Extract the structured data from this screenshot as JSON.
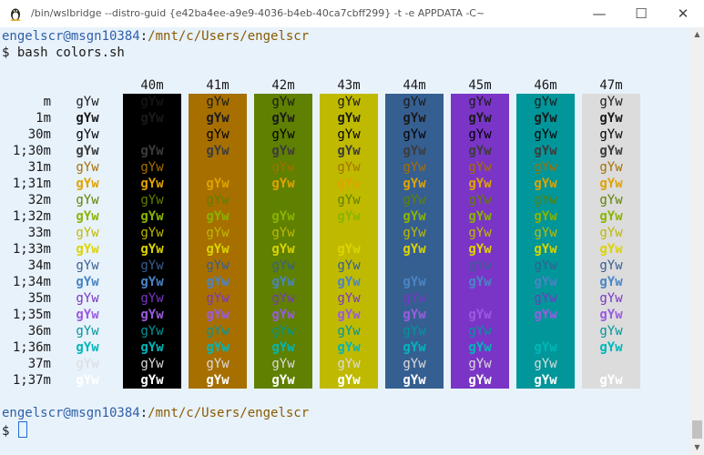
{
  "window": {
    "title": "/bin/wslbridge --distro-guid {e42ba4ee-a9e9-4036-b4eb-40ca7cbff299} -t -e APPDATA -C~",
    "minimize": "—",
    "maximize": "☐",
    "close": "✕",
    "icon": "tux-penguin-icon"
  },
  "terminal": {
    "prompt1": {
      "user_host": "engelscr@msgn10384",
      "colon": ":",
      "path": "/mnt/c/Users/engelscr"
    },
    "command": "$ bash colors.sh",
    "prompt2": {
      "user_host": "engelscr@msgn10384",
      "colon": ":",
      "path": "/mnt/c/Users/engelscr"
    },
    "prompt_line": "$ "
  },
  "colors": {
    "prompt_user": "#2f5ea8",
    "prompt_path": "#8a5a00",
    "bg_40": "#000000",
    "bg_41": "#a66f00",
    "bg_42": "#5f8000",
    "bg_43": "#bfba00",
    "bg_44": "#365f91",
    "bg_45": "#7a35c6",
    "bg_46": "#00969a",
    "bg_47": "#dcdcdc"
  },
  "grid": {
    "sample": "gYw",
    "columns": [
      "40m",
      "41m",
      "42m",
      "43m",
      "44m",
      "45m",
      "46m",
      "47m"
    ],
    "rows": [
      "m",
      "1m",
      "30m",
      "1;30m",
      "31m",
      "1;31m",
      "32m",
      "1;32m",
      "33m",
      "1;33m",
      "34m",
      "1;34m",
      "35m",
      "1;35m",
      "36m",
      "1;36m",
      "37m",
      "1;37m"
    ],
    "fg_normal": [
      "#000000",
      "#a66f00",
      "#5f8000",
      "#bfba00",
      "#365f91",
      "#7a35c6",
      "#00969a",
      "#dcdcdc"
    ],
    "fg_bold": [
      "#3c3c3c",
      "#e0a300",
      "#8ab400",
      "#dcd400",
      "#4a84c4",
      "#9a5be0",
      "#00b6ba",
      "#ffffff"
    ]
  }
}
